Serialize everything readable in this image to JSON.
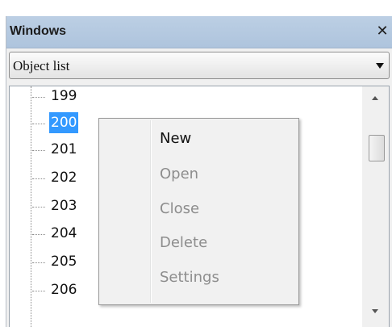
{
  "panel": {
    "title": "Windows",
    "close_glyph": "✕",
    "close_icon": "close-icon"
  },
  "selector": {
    "value": "Object list",
    "arrow_icon": "chevron-down-icon"
  },
  "tree": {
    "items": [
      {
        "label": "199",
        "selected": false
      },
      {
        "label": "200",
        "selected": true
      },
      {
        "label": "201",
        "selected": false
      },
      {
        "label": "202",
        "selected": false
      },
      {
        "label": "203",
        "selected": false
      },
      {
        "label": "204",
        "selected": false
      },
      {
        "label": "205",
        "selected": false
      },
      {
        "label": "206",
        "selected": false
      }
    ],
    "selection_color": "#3399ff"
  },
  "context_menu": {
    "items": [
      {
        "label": "New",
        "enabled": true
      },
      {
        "label": "Open",
        "enabled": false
      },
      {
        "label": "Close",
        "enabled": false
      },
      {
        "label": "Delete",
        "enabled": false
      },
      {
        "label": "Settings",
        "enabled": false
      }
    ]
  },
  "colors": {
    "titlebar": "#b4c9e1",
    "disabled_text": "#8d8d8d"
  }
}
